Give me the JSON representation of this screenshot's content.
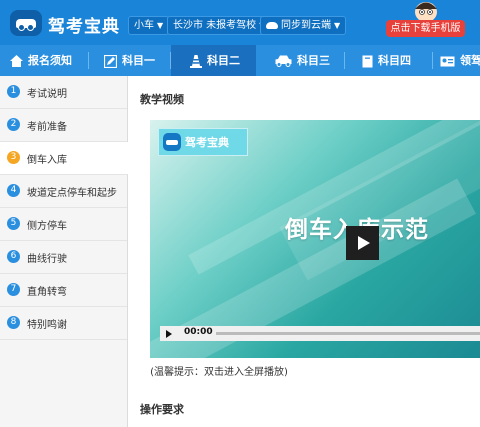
{
  "header": {
    "app_title": "驾考宝典",
    "car_type": "小车",
    "school": "长沙市 未报考驾校",
    "sync": "同步到云端",
    "download": "点击下载手机版",
    "accent_color": "#1a84d8",
    "download_color": "#e8413b"
  },
  "nav": {
    "tabs": [
      {
        "label": "报名须知",
        "icon": "house-icon"
      },
      {
        "label": "科目一",
        "icon": "pencil-icon"
      },
      {
        "label": "科目二",
        "icon": "traffic-cone-icon"
      },
      {
        "label": "科目三",
        "icon": "car-icon"
      },
      {
        "label": "科目四",
        "icon": "book-icon"
      },
      {
        "label": "领驾",
        "icon": "id-card-icon"
      }
    ],
    "active": "科目二"
  },
  "sidebar": {
    "items": [
      {
        "num": "1",
        "label": "考试说明"
      },
      {
        "num": "2",
        "label": "考前准备"
      },
      {
        "num": "3",
        "label": "倒车入库"
      },
      {
        "num": "4",
        "label": "坡道定点停车和起步"
      },
      {
        "num": "5",
        "label": "侧方停车"
      },
      {
        "num": "6",
        "label": "曲线行驶"
      },
      {
        "num": "7",
        "label": "直角转弯"
      },
      {
        "num": "8",
        "label": "特别鸣谢"
      }
    ],
    "active": "倒车入库"
  },
  "main": {
    "video_section_title": "教学视频",
    "video_logo_text": "驾考宝典",
    "video_caption": "倒车入库示范",
    "time": "00:00",
    "tip": "(温馨提示：双击进入全屏播放)",
    "requirements_title": "操作要求"
  }
}
